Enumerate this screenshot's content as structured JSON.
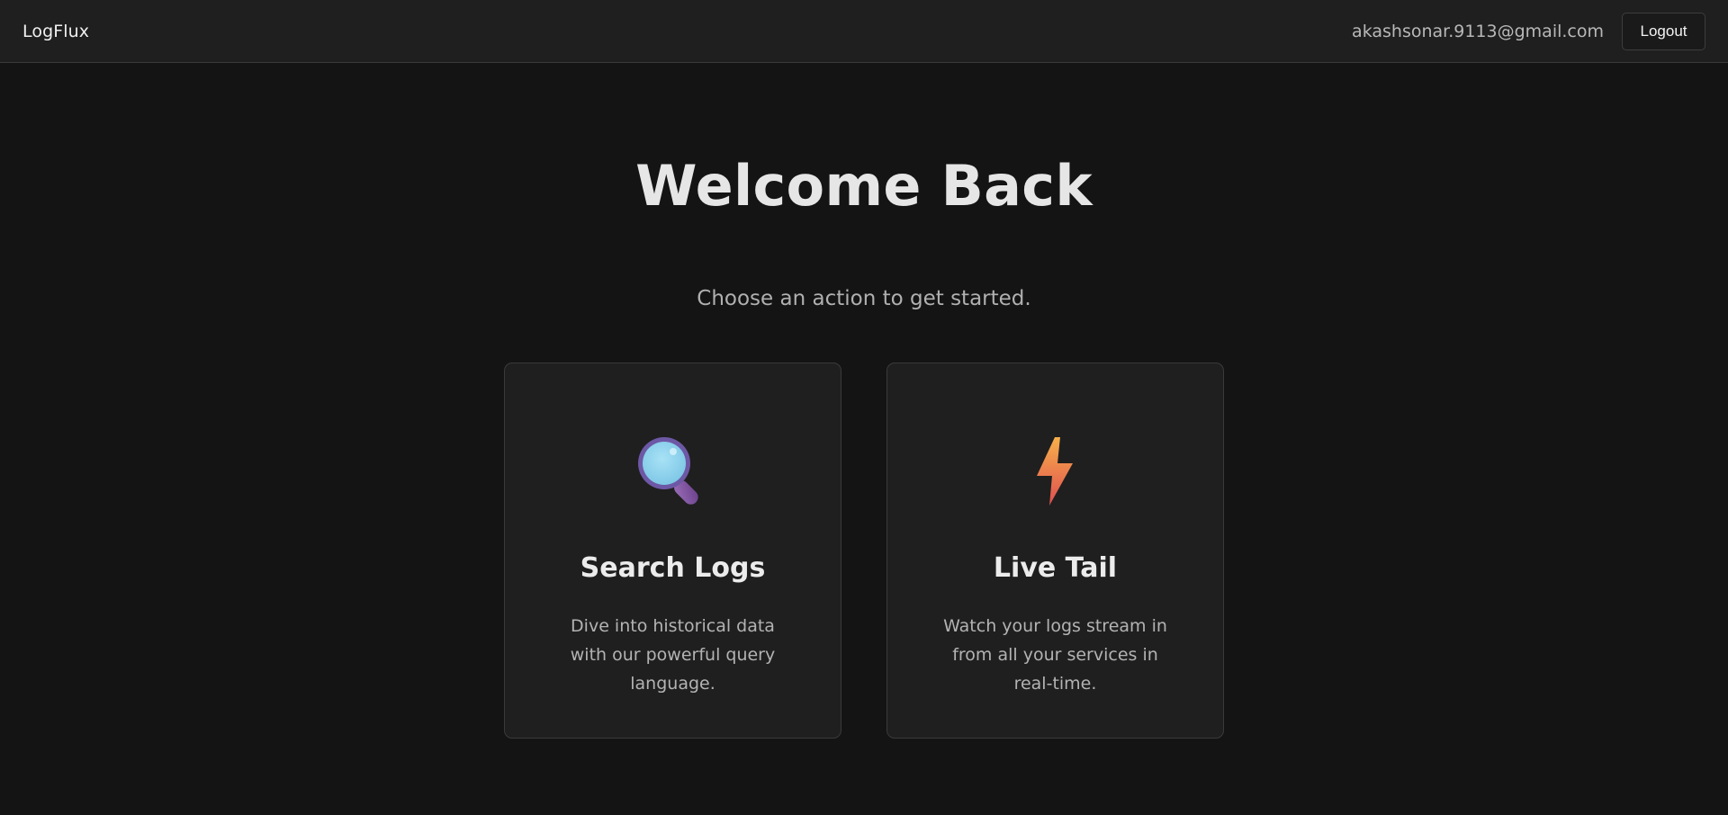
{
  "header": {
    "brand": "LogFlux",
    "user_email": "akashsonar.9113@gmail.com",
    "logout_label": "Logout"
  },
  "main": {
    "title": "Welcome Back",
    "subtitle": "Choose an action to get started.",
    "cards": [
      {
        "icon": "magnifying-glass-icon",
        "title": "Search Logs",
        "description": "Dive into historical data with our powerful query language."
      },
      {
        "icon": "lightning-bolt-icon",
        "title": "Live Tail",
        "description": "Watch your logs stream in from all your services in real-time."
      }
    ]
  },
  "colors": {
    "background": "#141414",
    "surface": "#1f1f1f",
    "border": "#3a3a3a",
    "magnifier_lens": "#8dd3ee",
    "magnifier_frame": "#6f5ba8",
    "bolt_top": "#f5a349",
    "bolt_bottom": "#e0514f"
  }
}
